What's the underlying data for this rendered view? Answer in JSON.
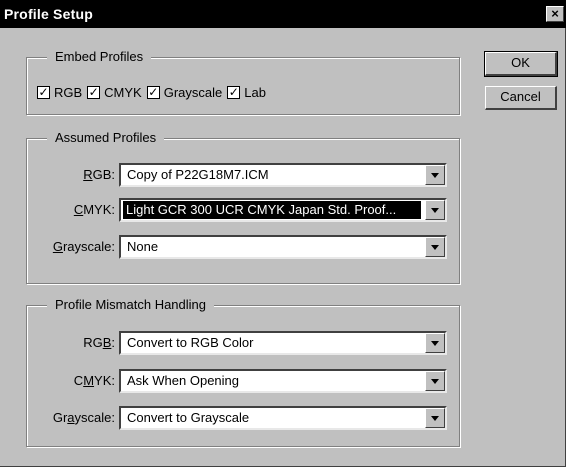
{
  "window": {
    "title": "Profile Setup",
    "close_glyph": "×"
  },
  "embed_profiles": {
    "title": "Embed Profiles",
    "check_glyph": "✓",
    "items": [
      {
        "label": "RGB",
        "checked": true
      },
      {
        "label": "CMYK",
        "checked": true
      },
      {
        "label": "Grayscale",
        "checked": true
      },
      {
        "label": "Lab",
        "checked": true
      }
    ]
  },
  "assumed_profiles": {
    "title": "Assumed Profiles",
    "rgb": {
      "label_pre": "",
      "label_u": "R",
      "label_post": "GB:",
      "value": "Copy of P22G18M7.ICM"
    },
    "cmyk": {
      "label_pre": "",
      "label_u": "C",
      "label_post": "MYK:",
      "value": "Light GCR 300 UCR CMYK Japan Std. Proof..."
    },
    "grayscale": {
      "label_pre": "",
      "label_u": "G",
      "label_post": "rayscale:",
      "value": "None"
    }
  },
  "mismatch_handling": {
    "title": "Profile Mismatch Handling",
    "rgb": {
      "label_pre": "RG",
      "label_u": "B",
      "label_post": ":",
      "value": "Convert to RGB Color"
    },
    "cmyk": {
      "label_pre": "C",
      "label_u": "M",
      "label_post": "YK:",
      "value": "Ask When Opening"
    },
    "grayscale": {
      "label_pre": "Gr",
      "label_u": "a",
      "label_post": "yscale:",
      "value": "Convert to Grayscale"
    }
  },
  "buttons": {
    "ok": "OK",
    "cancel": "Cancel"
  },
  "icons": {
    "close": "close-icon",
    "checkbox": "checkmark-icon",
    "dropdown": "dropdown-arrow-icon"
  },
  "colors": {
    "titlebar": "#000000",
    "face": "#c0c0c0",
    "field": "#ffffff",
    "selection": "#000000"
  }
}
